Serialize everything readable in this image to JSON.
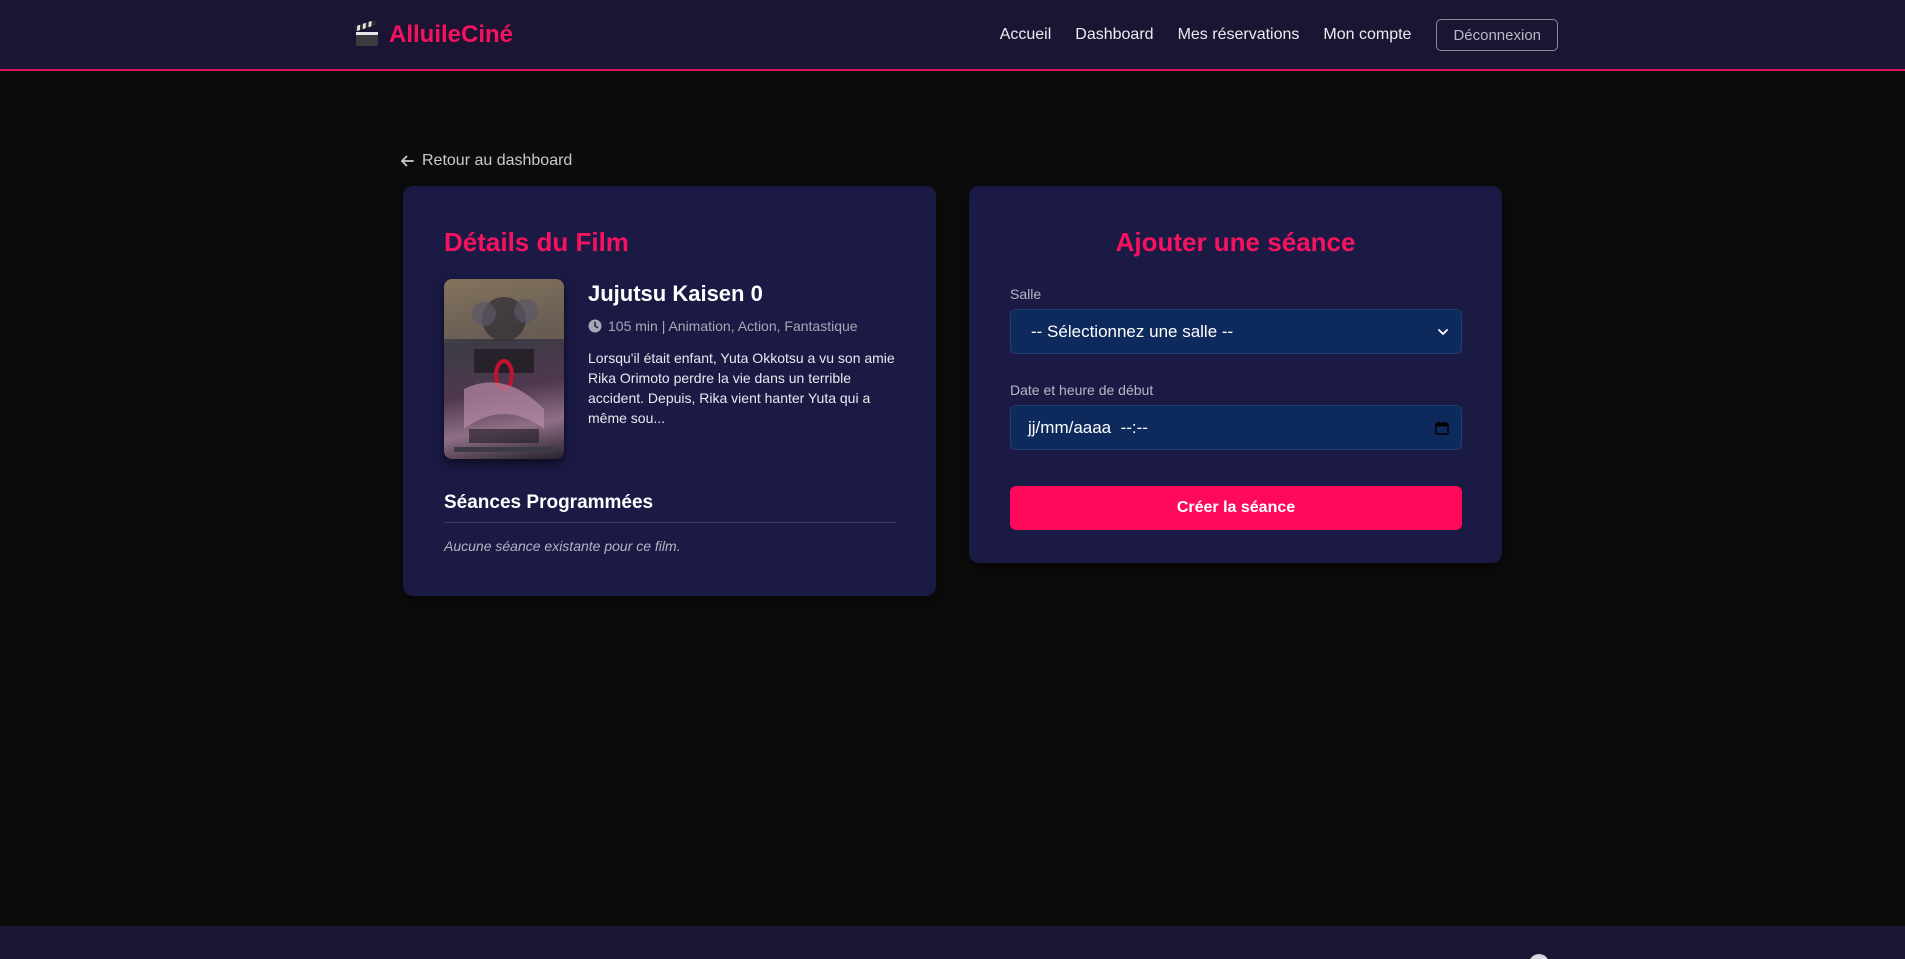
{
  "navbar": {
    "brand": "AlluileCiné",
    "brand_icon": "clapperboard-icon",
    "links": [
      "Accueil",
      "Dashboard",
      "Mes réservations",
      "Mon compte"
    ],
    "logout_label": "Déconnexion"
  },
  "back_link": {
    "icon": "arrow-left-icon",
    "label": "Retour au dashboard"
  },
  "film_card": {
    "title": "Détails du Film",
    "film": {
      "title": "Jujutsu Kaisen 0",
      "meta_icon": "clock-icon",
      "meta": "105 min | Animation, Action, Fantastique",
      "description": "Lorsqu'il était enfant, Yuta Okkotsu a vu son amie Rika Orimoto perdre la vie dans un terrible accident. Depuis, Rika vient hanter Yuta qui a même sou..."
    },
    "sessions_title": "Séances Programmées",
    "sessions_empty": "Aucune séance existante pour ce film."
  },
  "session_form": {
    "title": "Ajouter une séance",
    "room_label": "Salle",
    "room_selected": "-- Sélectionnez une salle --",
    "datetime_label": "Date et heure de début",
    "datetime_placeholder": "jj/mm/aaaa  --:--",
    "submit_label": "Créer la séance"
  },
  "colors": {
    "accent": "#f5125f",
    "navbar_bg": "#1c1433",
    "card_bg": "#1b1a45",
    "input_bg": "#0e2a5c",
    "page_bg": "#0c0c0c"
  }
}
